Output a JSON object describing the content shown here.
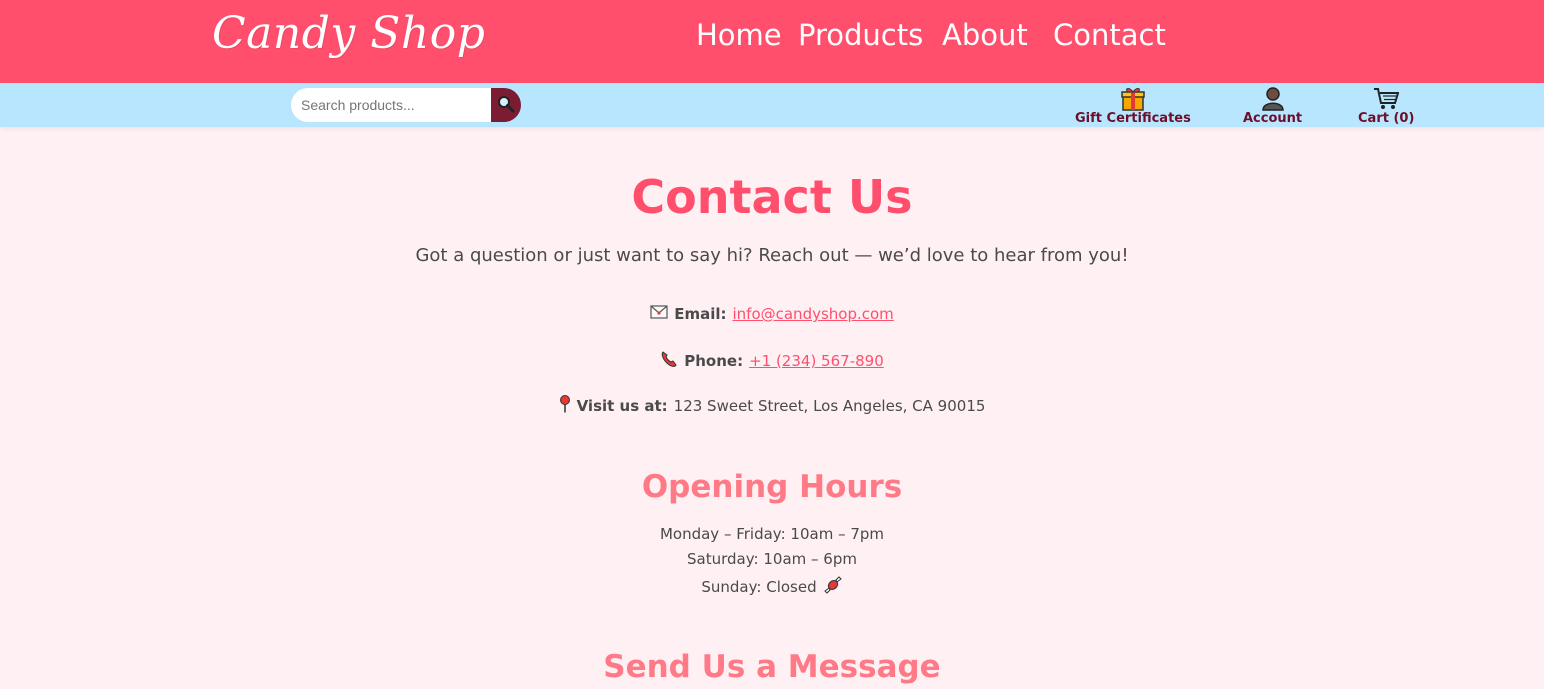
{
  "header": {
    "brand": "Candy Shop",
    "nav": [
      "Home",
      "Products",
      "About",
      "Contact"
    ]
  },
  "utility": {
    "search_placeholder": "Search products...",
    "gift_label": "Gift Certificates",
    "account_label": "Account",
    "cart_label": "Cart (0)"
  },
  "contact": {
    "title": "Contact Us",
    "lead": "Got a question or just want to say hi? Reach out — we’d love to hear from you!",
    "email_label": "Email:",
    "email_value": "info@candyshop.com",
    "phone_label": "Phone:",
    "phone_value": "+1 (234) 567-890",
    "visit_label": "Visit us at:",
    "visit_value": "123 Sweet Street, Los Angeles, CA 90015"
  },
  "hours": {
    "title": "Opening Hours",
    "lines": [
      "Monday – Friday: 10am – 7pm",
      "Saturday: 10am – 6pm",
      "Sunday: Closed"
    ]
  },
  "message": {
    "title": "Send Us a Message"
  },
  "colors": {
    "header_bg": "#ff4f6d",
    "utility_bg": "#b9e6ff",
    "page_bg": "#fff0f4",
    "accent": "#ff4f6d",
    "search_button": "#7b1c33"
  }
}
